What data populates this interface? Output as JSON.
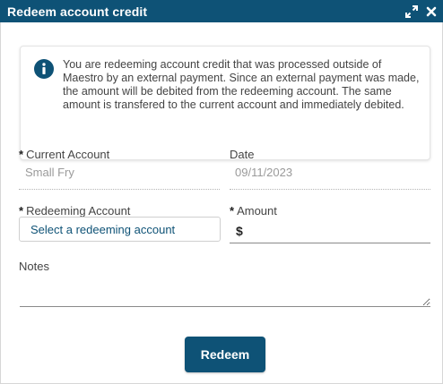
{
  "dialog": {
    "title": "Redeem account credit",
    "controls": {
      "expand_icon": "expand-icon",
      "close_icon": "close-icon"
    }
  },
  "info": {
    "icon": "info-icon",
    "message": "You are redeeming account credit that was processed outside of Maestro by an external payment. Since an external payment was made, the amount will be debited from the redeeming account. The same amount is transfered to the current account and immediately debited."
  },
  "form": {
    "required_marker": "*",
    "current_account": {
      "label": "Current Account",
      "value": "Small Fry"
    },
    "date": {
      "label": "Date",
      "value": "09/11/2023"
    },
    "redeeming_account": {
      "label": "Redeeming Account",
      "placeholder": "Select a redeeming account"
    },
    "amount": {
      "label": "Amount",
      "currency": "$",
      "value": ""
    },
    "notes": {
      "label": "Notes",
      "value": ""
    }
  },
  "actions": {
    "redeem_label": "Redeem"
  },
  "colors": {
    "header": "#0e5276",
    "accent": "#0e5276",
    "muted_text": "#9a9a9a"
  }
}
